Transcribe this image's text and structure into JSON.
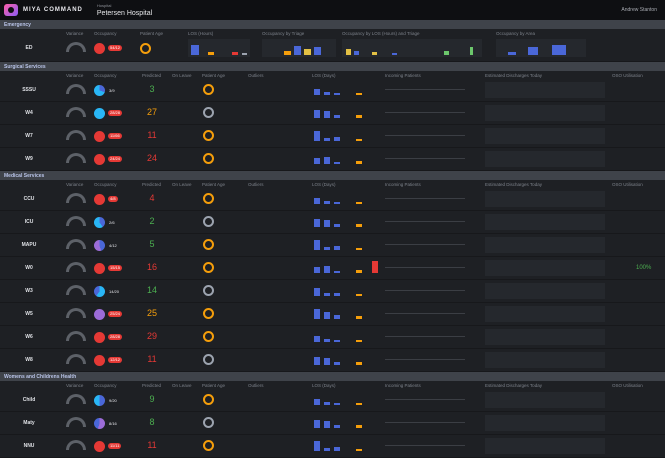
{
  "app": {
    "brand": "MIYA COMMAND",
    "hospital_label": "Hospital",
    "hospital_name": "Petersen Hospital",
    "user": "Andrew Stanton"
  },
  "colors": {
    "red": "#e53935",
    "green": "#4caf50",
    "orange": "#f59e0b",
    "blue": "#4a67d8",
    "purple": "#9c6cd8"
  },
  "sections": [
    {
      "title": "Emergency"
    },
    {
      "title": "Surgical Services"
    },
    {
      "title": "Medical Services"
    },
    {
      "title": "Womens and Childrens Health"
    }
  ],
  "ed_header": {
    "variance": "Variance",
    "occupancy": "Occupancy",
    "age": "Patient Age",
    "los": "LOS (Hours)",
    "triage": "Occupancy by Triage",
    "los_triage": "Occupancy by LOS (Hours) and Triage",
    "area": "Occupancy by Area"
  },
  "ed_row": {
    "unit": "ED",
    "occ": "54/12"
  },
  "ward_header": {
    "variance": "Variance",
    "occupancy": "Occupancy",
    "predicted": "Predicted",
    "on_leave": "On Leave",
    "age": "Patient Age",
    "outliers": "Outliers",
    "los": "LOS (Days)",
    "incoming": "Incoming Patients",
    "discharges": "Estimated Discharges Today",
    "util": "OSO Utilisation"
  },
  "surgical": [
    {
      "unit": "SSSU",
      "occ": "3/9",
      "predicted": "3",
      "pcolor": "#4caf50",
      "occ_red": false,
      "pie": "conic-gradient(#4a67d8 0 30%,#29b6f6 30% 100%)"
    },
    {
      "unit": "W4",
      "occ": "28/28",
      "predicted": "27",
      "pcolor": "#f59e0b",
      "occ_red": true,
      "pie": "conic-gradient(#29b6f6 0 100%)"
    },
    {
      "unit": "W7",
      "occ": "11/66",
      "predicted": "11",
      "pcolor": "#e53935",
      "occ_red": true,
      "pie": "conic-gradient(#e53935 0 100%)"
    },
    {
      "unit": "W9",
      "occ": "24/24",
      "predicted": "24",
      "pcolor": "#e53935",
      "occ_red": true,
      "pie": "conic-gradient(#e53935 0 100%)"
    }
  ],
  "medical": [
    {
      "unit": "CCU",
      "occ": "4/8",
      "predicted": "4",
      "pcolor": "#e53935",
      "occ_red": true,
      "pie": "conic-gradient(#e53935 0 100%)"
    },
    {
      "unit": "ICU",
      "occ": "2/6",
      "predicted": "2",
      "pcolor": "#4caf50",
      "occ_red": false,
      "pie": "conic-gradient(#4a67d8 0 40%,#29b6f6 40% 100%)"
    },
    {
      "unit": "MAPU",
      "occ": "4/12",
      "predicted": "5",
      "pcolor": "#4caf50",
      "occ_red": false,
      "pie": "conic-gradient(#4a67d8 0 45%,#9c6cd8 45% 100%)"
    },
    {
      "unit": "W0",
      "occ": "15/15",
      "predicted": "16",
      "pcolor": "#e53935",
      "occ_red": true,
      "pie": "conic-gradient(#e53935 0 100%)"
    },
    {
      "unit": "W3",
      "occ": "14/20",
      "predicted": "14",
      "pcolor": "#4caf50",
      "occ_red": false,
      "pie": "conic-gradient(#29b6f6 0 60%,#4a67d8 60% 100%)"
    },
    {
      "unit": "W5",
      "occ": "25/24",
      "predicted": "25",
      "pcolor": "#f59e0b",
      "occ_red": true,
      "pie": "conic-gradient(#9c6cd8 0 100%)"
    },
    {
      "unit": "W6",
      "occ": "28/28",
      "predicted": "29",
      "pcolor": "#e53935",
      "occ_red": true,
      "pie": "conic-gradient(#e53935 0 100%)"
    },
    {
      "unit": "W8",
      "occ": "12/12",
      "predicted": "11",
      "pcolor": "#e53935",
      "occ_red": true,
      "pie": "conic-gradient(#e53935 0 100%)"
    }
  ],
  "womens": [
    {
      "unit": "Child",
      "occ": "9/20",
      "predicted": "9",
      "pcolor": "#4caf50",
      "occ_red": false,
      "pie": "conic-gradient(#4a67d8 0 50%,#29b6f6 50% 100%)"
    },
    {
      "unit": "Maty",
      "occ": "8/16",
      "predicted": "8",
      "pcolor": "#4caf50",
      "occ_red": false,
      "pie": "conic-gradient(#9c6cd8 0 55%,#4a67d8 55% 100%)"
    },
    {
      "unit": "NNU",
      "occ": "11/11",
      "predicted": "11",
      "pcolor": "#e53935",
      "occ_red": true,
      "pie": "conic-gradient(#e53935 0 100%)"
    }
  ],
  "w0_util": "100%"
}
